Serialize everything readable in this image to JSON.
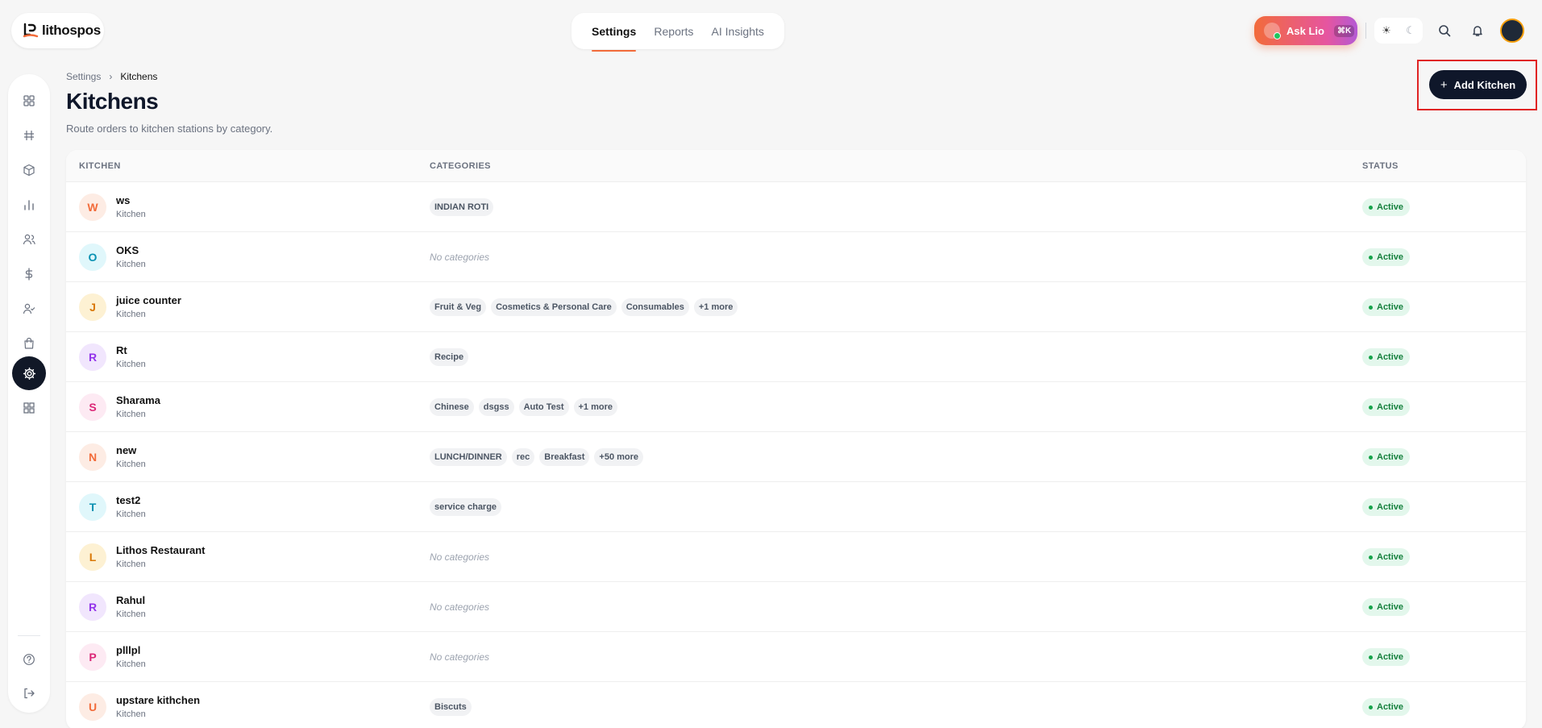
{
  "brand": {
    "name": "lithospos"
  },
  "topnav": {
    "tabs": [
      "Settings",
      "Reports",
      "AI Insights"
    ]
  },
  "asklio": {
    "label": "Ask Lio",
    "shortcut": "⌘K"
  },
  "breadcrumb": {
    "parent": "Settings",
    "current": "Kitchens"
  },
  "page": {
    "title": "Kitchens",
    "subtitle": "Route orders to kitchen stations by category.",
    "add_button": "Add Kitchen"
  },
  "table": {
    "headers": {
      "kitchen": "KITCHEN",
      "categories": "CATEGORIES",
      "status": "STATUS"
    },
    "no_categories": "No categories",
    "rows": [
      {
        "initial": "W",
        "name": "ws",
        "type": "Kitchen",
        "categories": [
          "INDIAN ROTI"
        ],
        "status": "Active",
        "color": "#f26b3a",
        "bg": "#fdece4"
      },
      {
        "initial": "O",
        "name": "OKS",
        "type": "Kitchen",
        "categories": [],
        "status": "Active",
        "color": "#0891b2",
        "bg": "#e0f7fb"
      },
      {
        "initial": "J",
        "name": "juice counter",
        "type": "Kitchen",
        "categories": [
          "Fruit & Veg",
          "Cosmetics & Personal Care",
          "Consumables",
          "+1 more"
        ],
        "status": "Active",
        "color": "#d97706",
        "bg": "#fdf1d3"
      },
      {
        "initial": "R",
        "name": "Rt",
        "type": "Kitchen",
        "categories": [
          "Recipe"
        ],
        "status": "Active",
        "color": "#9333ea",
        "bg": "#f1e6fd"
      },
      {
        "initial": "S",
        "name": "Sharama",
        "type": "Kitchen",
        "categories": [
          "Chinese",
          "dsgss",
          "Auto Test",
          "+1 more"
        ],
        "status": "Active",
        "color": "#db2777",
        "bg": "#fdeaf3"
      },
      {
        "initial": "N",
        "name": "new",
        "type": "Kitchen",
        "categories": [
          "LUNCH/DINNER",
          "rec",
          "Breakfast",
          "+50 more"
        ],
        "status": "Active",
        "color": "#f26b3a",
        "bg": "#fdece4"
      },
      {
        "initial": "T",
        "name": "test2",
        "type": "Kitchen",
        "categories": [
          "service charge"
        ],
        "status": "Active",
        "color": "#0891b2",
        "bg": "#e0f7fb"
      },
      {
        "initial": "L",
        "name": "Lithos Restaurant",
        "type": "Kitchen",
        "categories": [],
        "status": "Active",
        "color": "#d97706",
        "bg": "#fdf1d3"
      },
      {
        "initial": "R",
        "name": "Rahul",
        "type": "Kitchen",
        "categories": [],
        "status": "Active",
        "color": "#9333ea",
        "bg": "#f1e6fd"
      },
      {
        "initial": "P",
        "name": "plllpl",
        "type": "Kitchen",
        "categories": [],
        "status": "Active",
        "color": "#db2777",
        "bg": "#fdeaf3"
      },
      {
        "initial": "U",
        "name": "upstare kithchen",
        "type": "Kitchen",
        "categories": [
          "Biscuts"
        ],
        "status": "Active",
        "color": "#f26b3a",
        "bg": "#fdece4"
      }
    ]
  }
}
